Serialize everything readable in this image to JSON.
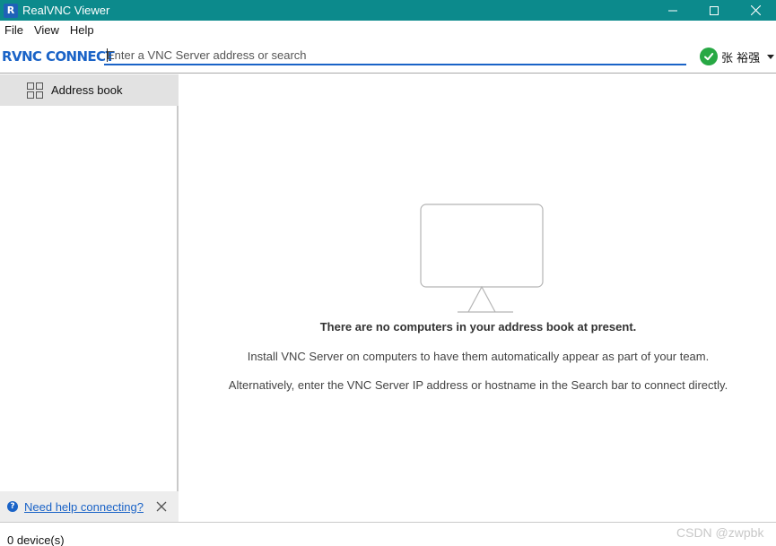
{
  "window": {
    "title": "RealVNC Viewer",
    "app_icon_letter": "R",
    "controls": [
      "minimize-icon",
      "maximize-icon",
      "close-icon"
    ]
  },
  "menubar": {
    "items": [
      "File",
      "View",
      "Help"
    ]
  },
  "toolbar": {
    "brand": "RVNC CONNECT",
    "search_placeholder": "Enter a VNC Server address or search",
    "search_value": "",
    "account_name": "张 裕强",
    "account_status_icon": "check-circle-icon"
  },
  "sidebar": {
    "items": [
      {
        "label": "Address book",
        "icon": "grid-icon",
        "selected": true
      }
    ],
    "help_link": "Need help connecting?",
    "help_icon": "help-icon"
  },
  "main": {
    "empty_icon": "monitor-icon",
    "empty_title": "There are no computers in your address book at present.",
    "empty_line1": "Install VNC Server on computers to have them automatically appear as part of your team.",
    "empty_line2": "Alternatively, enter the VNC Server IP address or hostname in the Search bar to connect directly."
  },
  "status": {
    "text": "0 device(s)",
    "watermark": "CSDN @zwpbk"
  },
  "colors": {
    "titlebar": "#0c8a8c",
    "accent": "#1a63c7",
    "success": "#27a844",
    "sidebar_selected": "#e2e2e2"
  }
}
